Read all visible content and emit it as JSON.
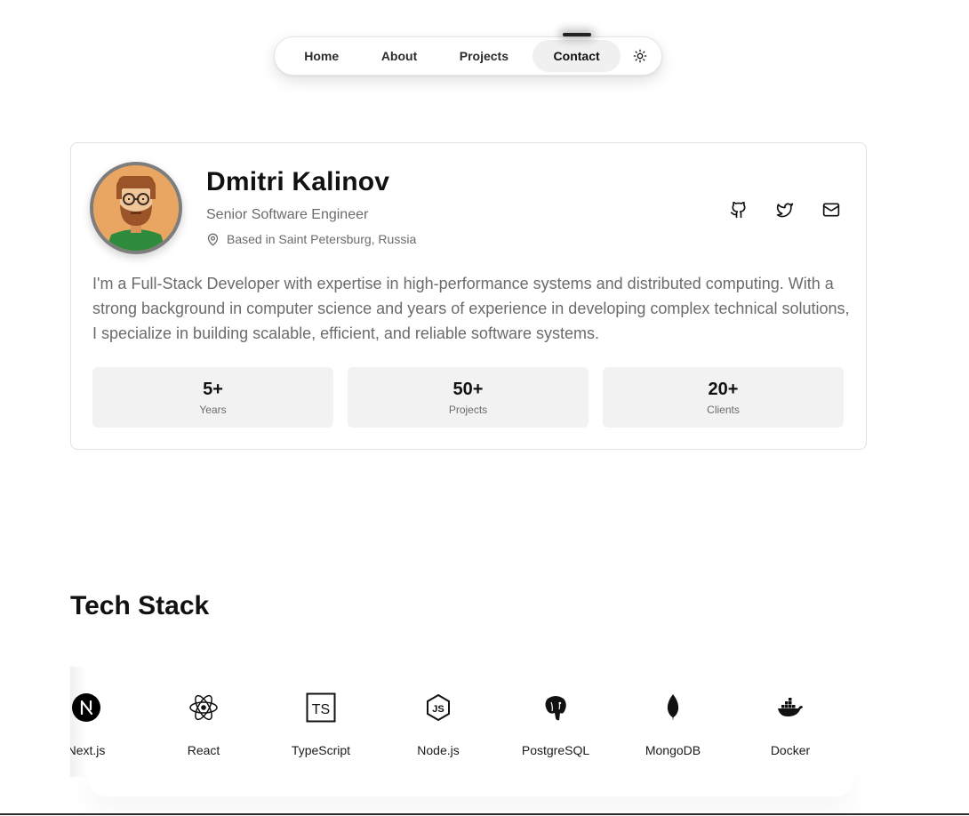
{
  "nav": {
    "items": [
      {
        "label": "Home"
      },
      {
        "label": "About"
      },
      {
        "label": "Projects"
      },
      {
        "label": "Contact",
        "active": true
      }
    ],
    "theme_toggle_icon": "sun-icon"
  },
  "profile": {
    "name": "Dmitri Kalinov",
    "role": "Senior Software Engineer",
    "location": "Based in Saint Petersburg, Russia",
    "bio": "I'm a Full-Stack Developer with expertise in high-performance systems and distributed computing. With a strong background in computer science and years of experience in developing complex technical solutions, I specialize in building scalable, efficient, and reliable software systems.",
    "socials": [
      {
        "icon": "github-icon"
      },
      {
        "icon": "twitter-icon"
      },
      {
        "icon": "mail-icon"
      }
    ],
    "stats": [
      {
        "value": "5+",
        "label": "Years"
      },
      {
        "value": "50+",
        "label": "Projects"
      },
      {
        "value": "20+",
        "label": "Clients"
      }
    ]
  },
  "tech_stack": {
    "title": "Tech Stack",
    "items": [
      {
        "label": "Next.js",
        "icon": "nextjs-icon"
      },
      {
        "label": "React",
        "icon": "react-icon"
      },
      {
        "label": "TypeScript",
        "icon": "typescript-icon"
      },
      {
        "label": "Node.js",
        "icon": "nodejs-icon"
      },
      {
        "label": "PostgreSQL",
        "icon": "postgresql-icon"
      },
      {
        "label": "MongoDB",
        "icon": "mongodb-icon"
      },
      {
        "label": "Docker",
        "icon": "docker-icon"
      }
    ]
  }
}
